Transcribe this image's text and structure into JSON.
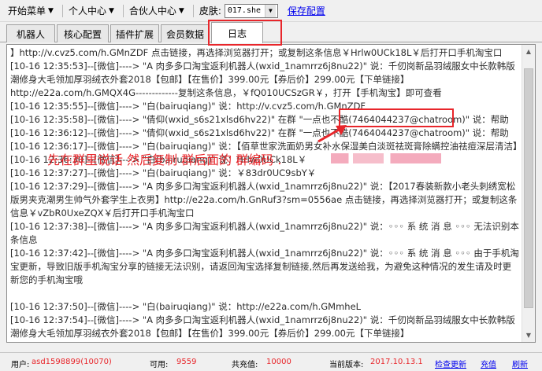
{
  "menubar": {
    "start_menu": "开始菜单",
    "personal_center": "个人中心",
    "partner_center": "合伙人中心",
    "skin_label": "皮肤:",
    "skin_value": "017.she",
    "save_config": "保存配置"
  },
  "tabs": [
    {
      "label": "机器人"
    },
    {
      "label": "核心配置"
    },
    {
      "label": "插件扩展"
    },
    {
      "label": "会员数据"
    },
    {
      "label": "日志"
    }
  ],
  "log": [
    "】http://v.cvz5.com/h.GMnZDF 点击链接，再选择浏览器打开；或复制这条信息￥Hrlw0UCk18L￥后打开口手机淘宝口",
    "[10-16 12:35:53]--[微信]----> \"A 肉多多口淘宝返利机器人(wxid_1namrrz6j8nu22)\" 说：千仞岗新品羽绒服女中长款韩版潮修身大毛领加厚羽绒衣外套2018【包邮】【在售价】399.00元【券后价】299.00元【下单链接】",
    "http://e22a.com/h.GMQX4G-------------复制这条信息，￥fQ010UCSzGR￥，打开【手机淘宝】即可查看",
    "[10-16 12:35:55]--[微信]----> \"白(bairuqiang)\" 说：http://v.cvz5.com/h.GMnZDF",
    "[10-16 12:35:58]--[微信]----> \"倩仰(wxid_s6s21xlsd6hv22)\" 在群 \"一点也不酷(7464044237@chatroom)\" 说：帮助",
    "[10-16 12:36:12]--[微信]----> \"倩仰(wxid_s6s21xlsd6hv22)\" 在群 \"一点也不酷(7464044237@chatroom)\" 说：帮助",
    "[10-16 12:36:17]--[微信]----> \"白(bairuqiang)\" 说：【佰草世家洗面奶男女补水保湿美白淡斑祛斑膏除螨控油祛痘深层清洁】",
    "[10-16 12:36:30]--[微信]----> \"白(bairuqiang)\" 说：Hrlw0UCk18L￥",
    "[10-16 12:37:27]--[微信]----> \"白(bairuqiang)\" 说：￥83dr0UC9sbY￥",
    "[10-16 12:37:29]--[微信]----> \"A 肉多多口淘宝返利机器人(wxid_1namrrz6j8nu22)\" 说：【2017春装新款小老头刺绣宽松版男夹克潮男生帅气外套学生上衣男】http://e22a.com/h.GnRuf3?sm=0556ae 点击链接，再选择浏览器打开；或复制这条信息￥vZbR0UxeZQX￥后打开口手机淘宝口",
    "[10-16 12:37:38]--[微信]----> \"A 肉多多口淘宝返利机器人(wxid_1namrrz6j8nu22)\" 说：◦◦◦ 系 统 消 息 ◦◦◦ 无法识别本条信息",
    "[10-16 12:37:42]--[微信]----> \"A 肉多多口淘宝返利机器人(wxid_1namrrz6j8nu22)\" 说：◦◦◦ 系 统 消 息 ◦◦◦ 由于手机淘宝更新，导致旧版手机淘宝分享的链接无法识别，请返回淘宝选择复制链接,然后再发送给我，为避免这种情况的发生请及时更新您的手机淘宝哦",
    "",
    "[10-16 12:37:50]--[微信]----> \"白(bairuqiang)\" 说：http://e22a.com/h.GMmheL",
    "[10-16 12:37:54]--[微信]----> \"A 肉多多口淘宝返利机器人(wxid_1namrrz6j8nu22)\" 说：千仞岗新品羽绒服女中长款韩版潮修身大毛领加厚羽绒衣外套2018【包邮】【在售价】399.00元【券后价】299.00元【下单链接】"
  ],
  "annotation": {
    "text": "先在群里说话 然后复制 群后面的 群编码 ."
  },
  "statusbar": {
    "user_label": "用户:",
    "user_value": "asd1598899(10070)",
    "available_label": "可用:",
    "available_value": "9559",
    "total_recharge_label": "共充值:",
    "total_recharge_value": "10000",
    "version_label": "当前版本:",
    "version_value": "2017.10.13.1",
    "check_update": "检查更新",
    "recharge": "充值",
    "refresh": "刷新"
  },
  "colors": {
    "annotation_red": "#e8262b",
    "link_blue": "#0000ee"
  }
}
